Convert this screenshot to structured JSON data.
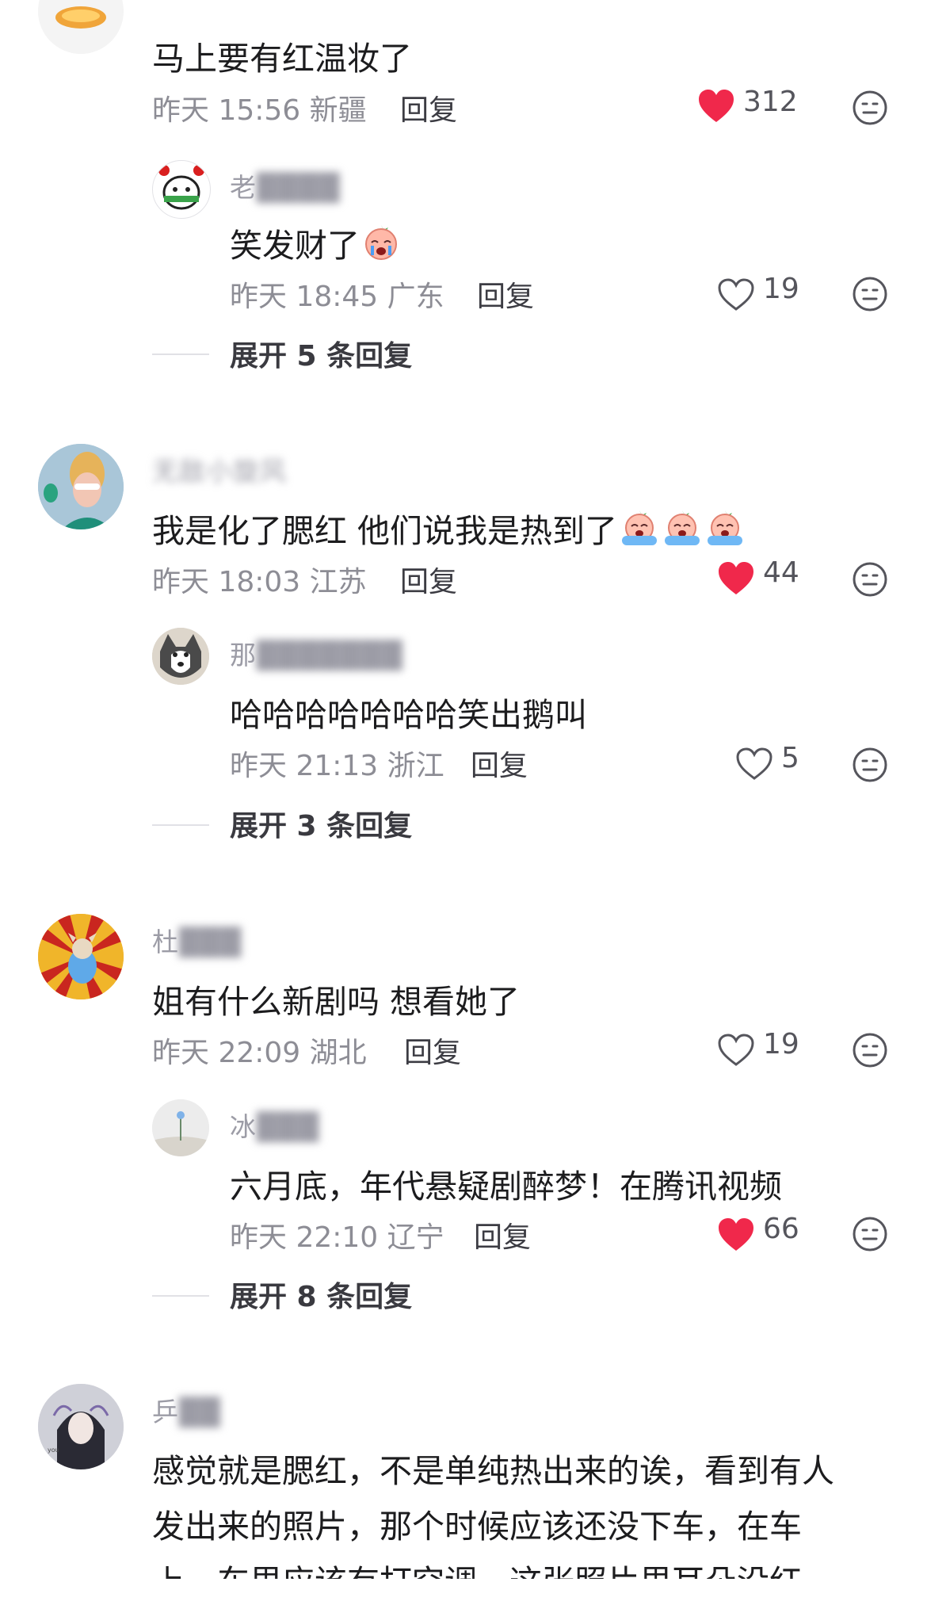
{
  "colors": {
    "liked_heart": "#f0284b",
    "meta_gray": "#8d8d95",
    "name_gray": "#9c9ca6"
  },
  "comments": [
    {
      "name": "",
      "text": "马上要有红温妆了",
      "time": "昨天 15:56 新疆",
      "reply_label": "回复",
      "likes": "312",
      "liked": true,
      "replies": [
        {
          "name": "老",
          "text": "笑发财了",
          "time": "昨天 18:45 广东",
          "reply_label": "回复",
          "likes": "19",
          "liked": false
        }
      ],
      "expand_label": "展开 5 条回复"
    },
    {
      "name": "无敌小旋风",
      "text": "我是化了腮红 他们说我是热到了",
      "time": "昨天 18:03 江苏",
      "reply_label": "回复",
      "likes": "44",
      "liked": true,
      "replies": [
        {
          "name": "那",
          "text": "哈哈哈哈哈哈哈笑出鹅叫",
          "time": "昨天 21:13 浙江",
          "reply_label": "回复",
          "likes": "5",
          "liked": false
        }
      ],
      "expand_label": "展开 3 条回复"
    },
    {
      "name": "杜",
      "text": "姐有什么新剧吗 想看她了",
      "time": "昨天 22:09 湖北",
      "reply_label": "回复",
      "likes": "19",
      "liked": false,
      "replies": [
        {
          "name": "冰",
          "text": "六月底，年代悬疑剧醉梦！在腾讯视频",
          "time": "昨天 22:10 辽宁",
          "reply_label": "回复",
          "likes": "66",
          "liked": true
        }
      ],
      "expand_label": "展开 8 条回复"
    },
    {
      "name": "乒",
      "text_lines": [
        "感觉就是腮红，不是单纯热出来的诶，看到有人",
        "发出来的照片，那个时候应该还没下车，在车",
        "上，车里应该有打空调，这张照片里耳朵没红"
      ]
    }
  ]
}
